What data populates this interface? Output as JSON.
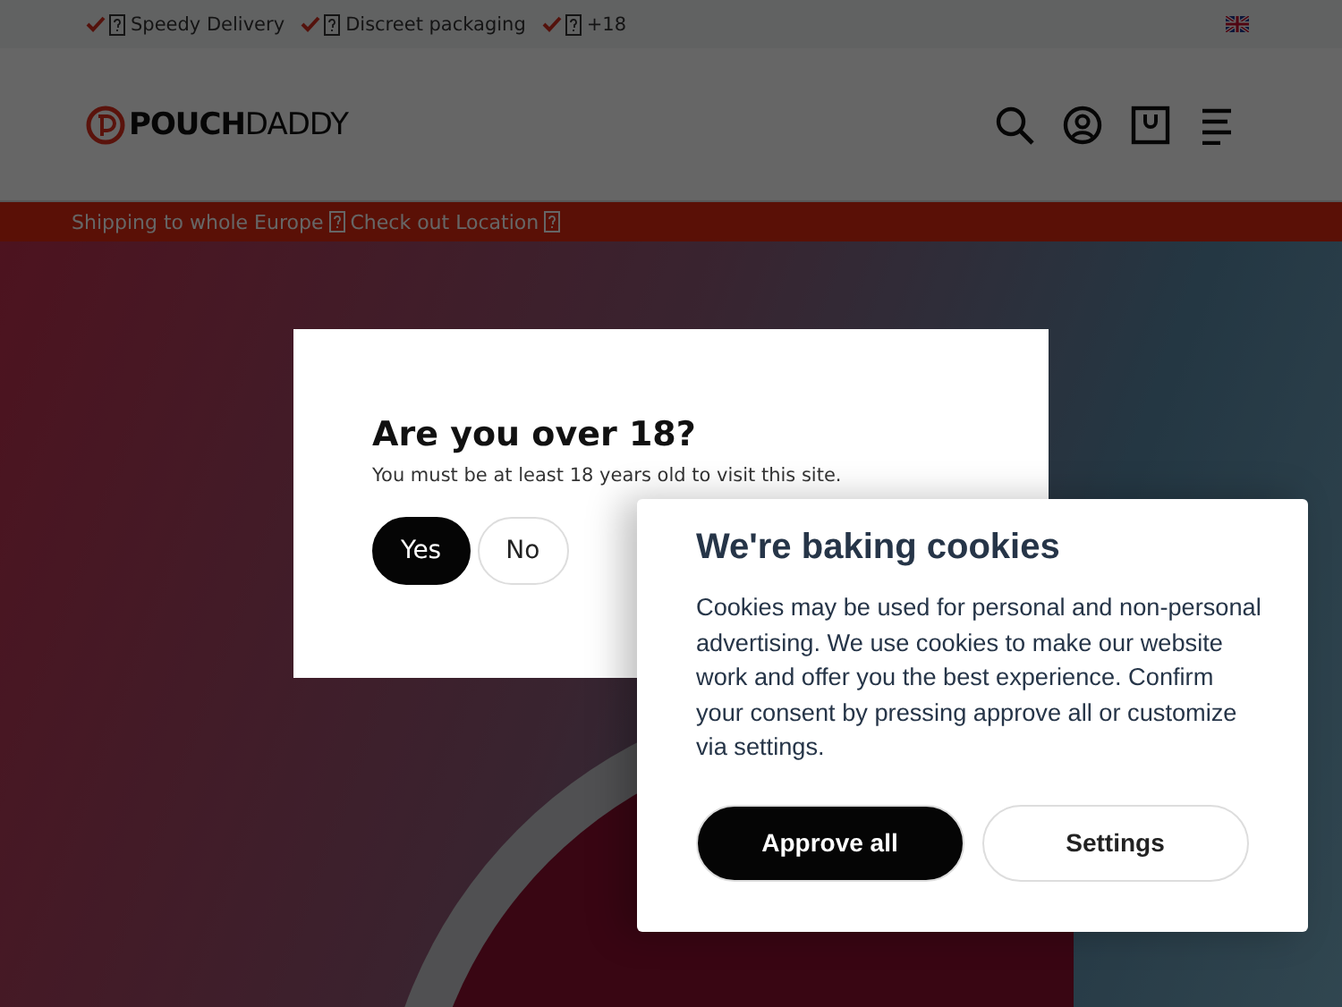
{
  "top_bar": {
    "features": [
      {
        "label": "Speedy Delivery"
      },
      {
        "label": "Discreet packaging"
      },
      {
        "label": "+18"
      }
    ]
  },
  "header": {
    "logo": {
      "bold": "POUCH",
      "light": "DADDY"
    }
  },
  "promo_strip": {
    "parts": [
      "Shipping to whole Europe",
      "Check out Location"
    ]
  },
  "age_dialog": {
    "title": "Are you over 18?",
    "text": "You must be at least 18 years old to visit this site.",
    "buttons": [
      {
        "label": "Yes",
        "kind": "primary"
      },
      {
        "label": "No",
        "kind": "secondary"
      }
    ]
  },
  "cookie_panel": {
    "title": "We're baking cookies",
    "text": "Cookies may be used for personal and non-personal advertising. We use cookies to make our website work and offer you the best experience. Confirm your consent by pressing approve all or customize via settings.",
    "buttons": [
      {
        "label": "Approve all",
        "kind": "primary"
      },
      {
        "label": "Settings",
        "kind": "secondary"
      }
    ]
  }
}
